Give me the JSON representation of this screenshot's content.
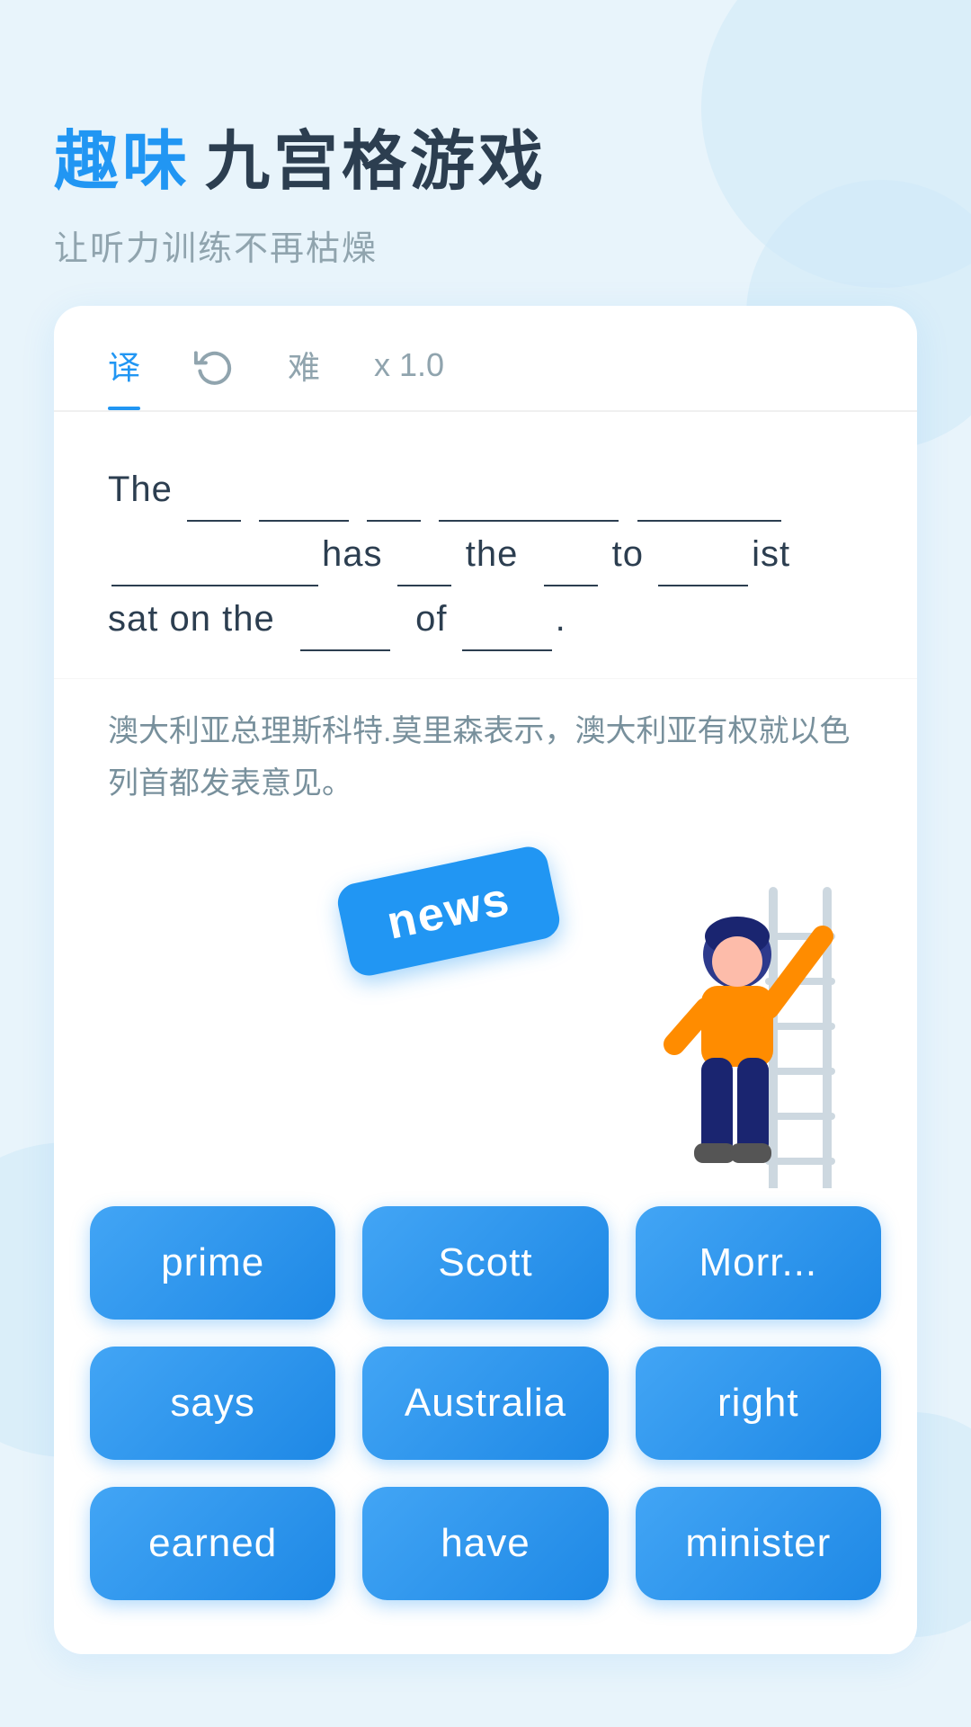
{
  "header": {
    "title_highlight": "趣味",
    "title_main": "九宫格游戏",
    "subtitle": "让听力训练不再枯燥"
  },
  "tabs": [
    {
      "id": "translate",
      "label": "译",
      "active": true
    },
    {
      "id": "refresh",
      "label": "↻",
      "icon": true
    },
    {
      "id": "difficulty",
      "label": "难",
      "active": false
    },
    {
      "id": "speed",
      "label": "x 1.0",
      "active": false
    }
  ],
  "sentence": {
    "text": "The ___ ______ ___ _________ _____ ________has ___ the ___ to _____ist sat on the ____ of ___.",
    "translation": "澳大利亚总理斯科特.莫里森表示，澳大利亚有权就以色列首都发表意见。"
  },
  "news_chip": "news",
  "words": [
    {
      "id": "prime",
      "label": "prime"
    },
    {
      "id": "scott",
      "label": "Scott"
    },
    {
      "id": "morrison",
      "label": "Morr..."
    },
    {
      "id": "says",
      "label": "says"
    },
    {
      "id": "australia",
      "label": "Australia"
    },
    {
      "id": "right",
      "label": "right"
    },
    {
      "id": "earned",
      "label": "earned"
    },
    {
      "id": "have",
      "label": "have"
    },
    {
      "id": "minister",
      "label": "minister"
    }
  ]
}
